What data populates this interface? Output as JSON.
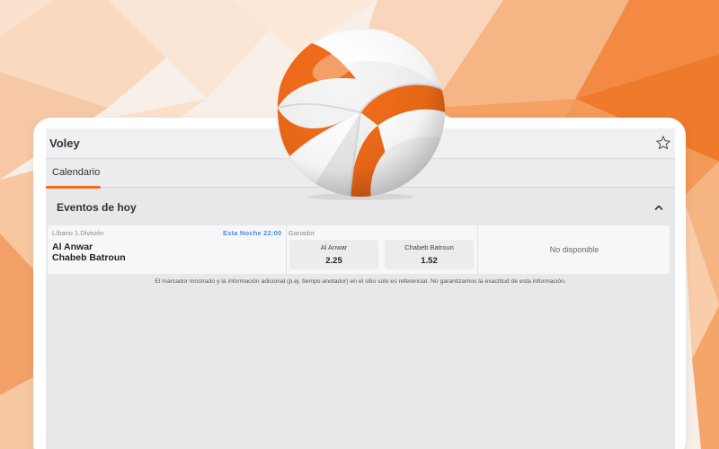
{
  "app": {
    "title": "Voley"
  },
  "tabs": [
    {
      "label": "Calendario"
    }
  ],
  "section": {
    "title": "Eventos de hoy"
  },
  "event": {
    "league": "Líbano 1.División",
    "time": "Esta Noche 22:00",
    "team1": "Al Anwar",
    "team2": "Chabeb Batroun",
    "market": "Ganador",
    "odds": [
      {
        "name": "Al Anwar",
        "value": "2.25"
      },
      {
        "name": "Chabeb Batroun",
        "value": "1.52"
      }
    ],
    "unavailable": "No disponible"
  },
  "disclaimer": "El marcador mostrado y la información adicional (p.ej. tiempo anotador) en el sitio solo es referencial. No garantizamos la exactitud de esta información.",
  "colors": {
    "accent": "#f26a1b",
    "time": "#4a8fd6",
    "background": "#f5e4d6"
  },
  "icons": {
    "favorite": "star-icon",
    "collapse": "chevron-up-icon",
    "illustration": "volleyball-icon"
  }
}
